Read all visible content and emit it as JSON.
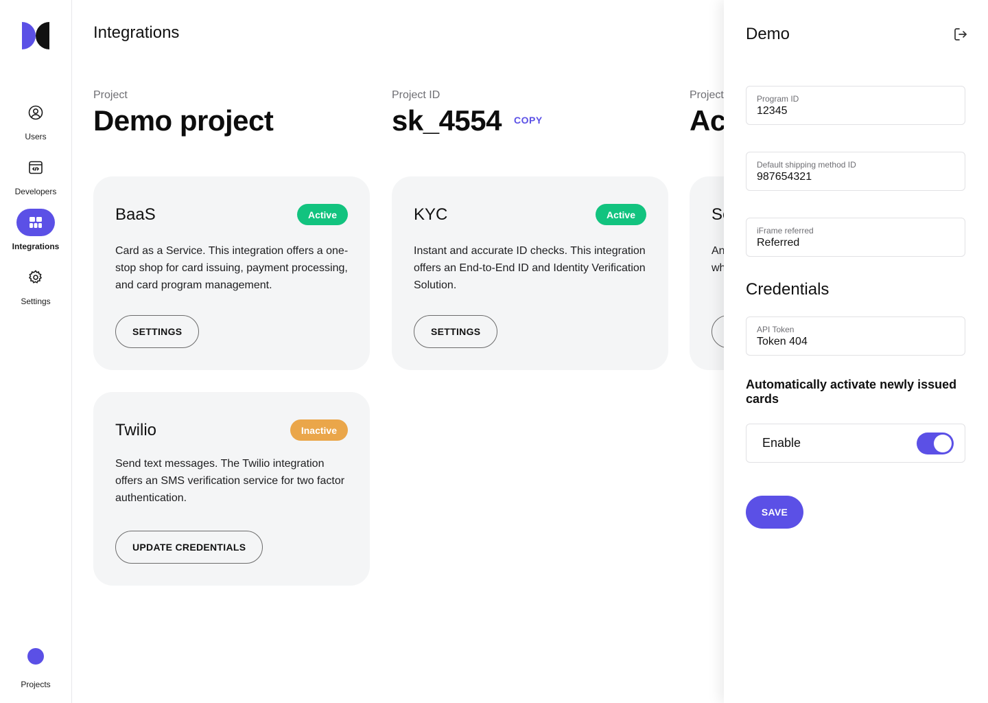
{
  "sidebar": {
    "logo_icon": "brand-logo",
    "items": [
      {
        "label": "Users",
        "icon": "user-circle-icon",
        "active": false
      },
      {
        "label": "Developers",
        "icon": "code-window-icon",
        "active": false
      },
      {
        "label": "Integrations",
        "icon": "integrations-icon",
        "active": true
      },
      {
        "label": "Settings",
        "icon": "gear-icon",
        "active": false
      }
    ],
    "projects_label": "Projects"
  },
  "header": {
    "title": "Integrations"
  },
  "project": {
    "name_label": "Project",
    "name_value": "Demo project",
    "id_label": "Project ID",
    "id_value": "sk_4554",
    "copy_label": "COPY",
    "status_label": "Project",
    "status_value": "Act"
  },
  "cards": [
    {
      "title": "BaaS",
      "status": "Active",
      "description": "Card as a Service. This integration offers a one-stop shop for card issuing, payment processing, and card program management.",
      "button": "SETTINGS"
    },
    {
      "title": "KYC",
      "status": "Active",
      "description": "Instant and accurate ID checks. This integration offers an End-to-End ID and Identity Verification Solution.",
      "button": "SETTINGS"
    },
    {
      "title": "Se",
      "status": "",
      "description": "An wh",
      "button": ""
    },
    {
      "title": "Twilio",
      "status": "Inactive",
      "description": "Send text messages. The Twilio integration offers an SMS verification service for two factor authentication.",
      "button": "UPDATE CREDENTIALS"
    }
  ],
  "panel": {
    "title": "Demo",
    "fields": [
      {
        "label": "Program ID",
        "value": "12345"
      },
      {
        "label": "Default shipping method ID",
        "value": "987654321"
      },
      {
        "label": "iFrame referred",
        "value": "Referred"
      }
    ],
    "credentials_title": "Credentials",
    "credentials": [
      {
        "label": "API Token",
        "value": "Token 404"
      }
    ],
    "toggle_title": "Automatically activate newly issued cards",
    "toggle_label": "Enable",
    "toggle_on": true,
    "save_label": "SAVE"
  },
  "colors": {
    "accent": "#5b50e6",
    "active": "#12c37f",
    "inactive": "#eaa64a",
    "card_bg": "#f4f5f6"
  }
}
